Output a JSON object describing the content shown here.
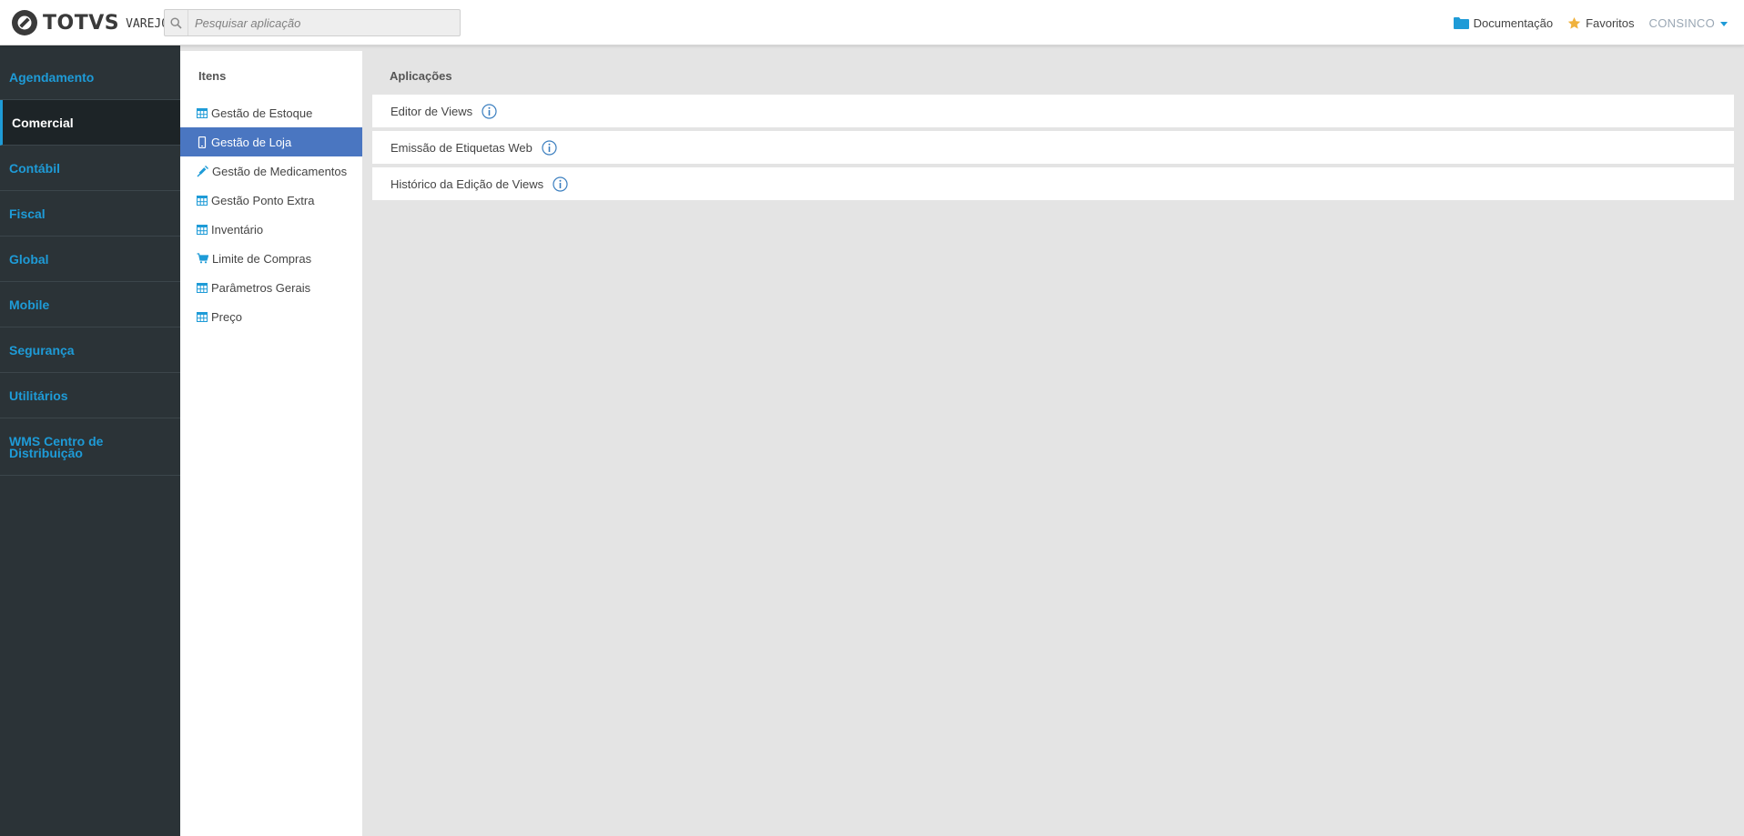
{
  "header": {
    "logo_text": "TOTVS",
    "logo_sub": "VAREJO",
    "search_placeholder": "Pesquisar aplicação",
    "documentation_label": "Documentação",
    "favorites_label": "Favoritos",
    "user_label": "CONSINCO"
  },
  "colors": {
    "accent": "#1e9bd7",
    "sidebar_bg": "#2b3337",
    "active_item_bg": "#4a76c1",
    "favorites_star": "#f0b23c"
  },
  "sidebar": {
    "items": [
      {
        "label": "Agendamento"
      },
      {
        "label": "Comercial",
        "active": true
      },
      {
        "label": "Contábil"
      },
      {
        "label": "Fiscal"
      },
      {
        "label": "Global"
      },
      {
        "label": "Mobile"
      },
      {
        "label": "Segurança"
      },
      {
        "label": "Utilitários"
      },
      {
        "label": "WMS Centro de Distribuição"
      }
    ]
  },
  "items_panel": {
    "title": "Itens",
    "items": [
      {
        "label": "Gestão de Estoque",
        "icon": "table-icon"
      },
      {
        "label": "Gestão de Loja",
        "icon": "mobile-icon",
        "active": true
      },
      {
        "label": "Gestão de Medicamentos",
        "icon": "syringe-icon"
      },
      {
        "label": "Gestão Ponto Extra",
        "icon": "table-icon"
      },
      {
        "label": "Inventário",
        "icon": "table-icon"
      },
      {
        "label": "Limite de Compras",
        "icon": "cart-icon"
      },
      {
        "label": "Parâmetros Gerais",
        "icon": "table-icon"
      },
      {
        "label": "Preço",
        "icon": "table-icon"
      }
    ]
  },
  "apps_panel": {
    "title": "Aplicações",
    "apps": [
      {
        "label": "Editor de Views"
      },
      {
        "label": "Emissão de Etiquetas Web"
      },
      {
        "label": "Histórico da Edição de Views"
      }
    ]
  }
}
